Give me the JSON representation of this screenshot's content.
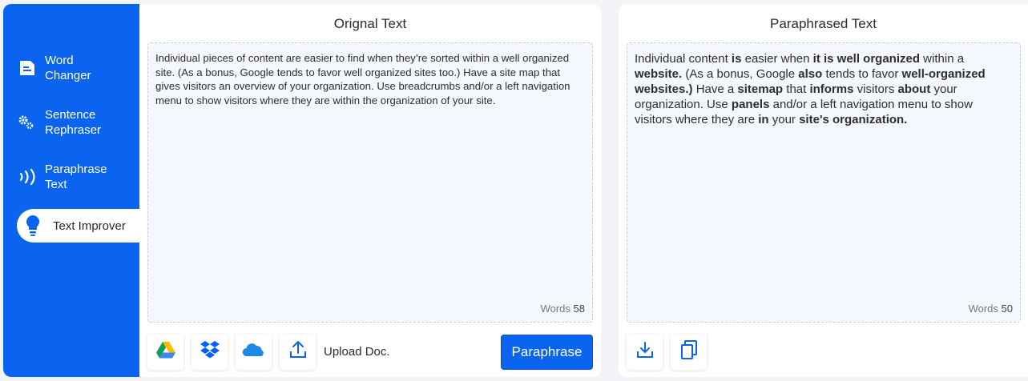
{
  "sidebar": {
    "items": [
      {
        "label_line1": "Word",
        "label_line2": "Changer",
        "icon": "document-icon",
        "active": false
      },
      {
        "label_line1": "Sentence",
        "label_line2": "Rephraser",
        "icon": "gears-icon",
        "active": false
      },
      {
        "label_line1": "Paraphrase",
        "label_line2": "Text",
        "icon": "sound-waves-icon",
        "active": false
      },
      {
        "label": "Text Improver",
        "icon": "lightbulb-icon",
        "active": true
      }
    ]
  },
  "original": {
    "title": "Orignal Text",
    "text": "Individual pieces of content are easier to find when they’re sorted within a well organized site. (As a bonus, Google tends to favor well organized sites too.) Have a site map that gives visitors an overview of your organization. Use breadcrumbs and/or a left navigation menu to show visitors where they are within the organization of your site.",
    "words_label": "Words",
    "words_count": "58"
  },
  "toolbar": {
    "google_drive_icon": "google-drive-icon",
    "dropbox_icon": "dropbox-icon",
    "onedrive_icon": "onedrive-icon",
    "upload_icon": "upload-icon",
    "upload_label": "Upload Doc.",
    "paraphrase_label": "Paraphrase"
  },
  "paraphrased": {
    "title": "Paraphrased Text",
    "segments": [
      {
        "t": "Individual content ",
        "b": false
      },
      {
        "t": "is",
        "b": true
      },
      {
        "t": " easier when ",
        "b": false
      },
      {
        "t": "it is well organized",
        "b": true
      },
      {
        "t": " within a ",
        "b": false
      },
      {
        "t": "website.",
        "b": true
      },
      {
        "t": " (As a bonus, Google ",
        "b": false
      },
      {
        "t": "also",
        "b": true
      },
      {
        "t": " tends to favor ",
        "b": false
      },
      {
        "t": "well-organized websites.)",
        "b": true
      },
      {
        "t": " Have a ",
        "b": false
      },
      {
        "t": "sitemap",
        "b": true
      },
      {
        "t": " that ",
        "b": false
      },
      {
        "t": "informs",
        "b": true
      },
      {
        "t": " visitors ",
        "b": false
      },
      {
        "t": "about",
        "b": true
      },
      {
        "t": " your organization. Use ",
        "b": false
      },
      {
        "t": "panels",
        "b": true
      },
      {
        "t": " and/or a left navigation menu to show visitors where they are ",
        "b": false
      },
      {
        "t": "in",
        "b": true
      },
      {
        "t": " your ",
        "b": false
      },
      {
        "t": "site's organization.",
        "b": true
      }
    ],
    "words_label": "Words",
    "words_count": "50",
    "download_icon": "download-icon",
    "copy_icon": "copy-icon"
  },
  "colors": {
    "brand_blue": "#0a64f0",
    "text_area_bg": "#f4f7fd"
  }
}
